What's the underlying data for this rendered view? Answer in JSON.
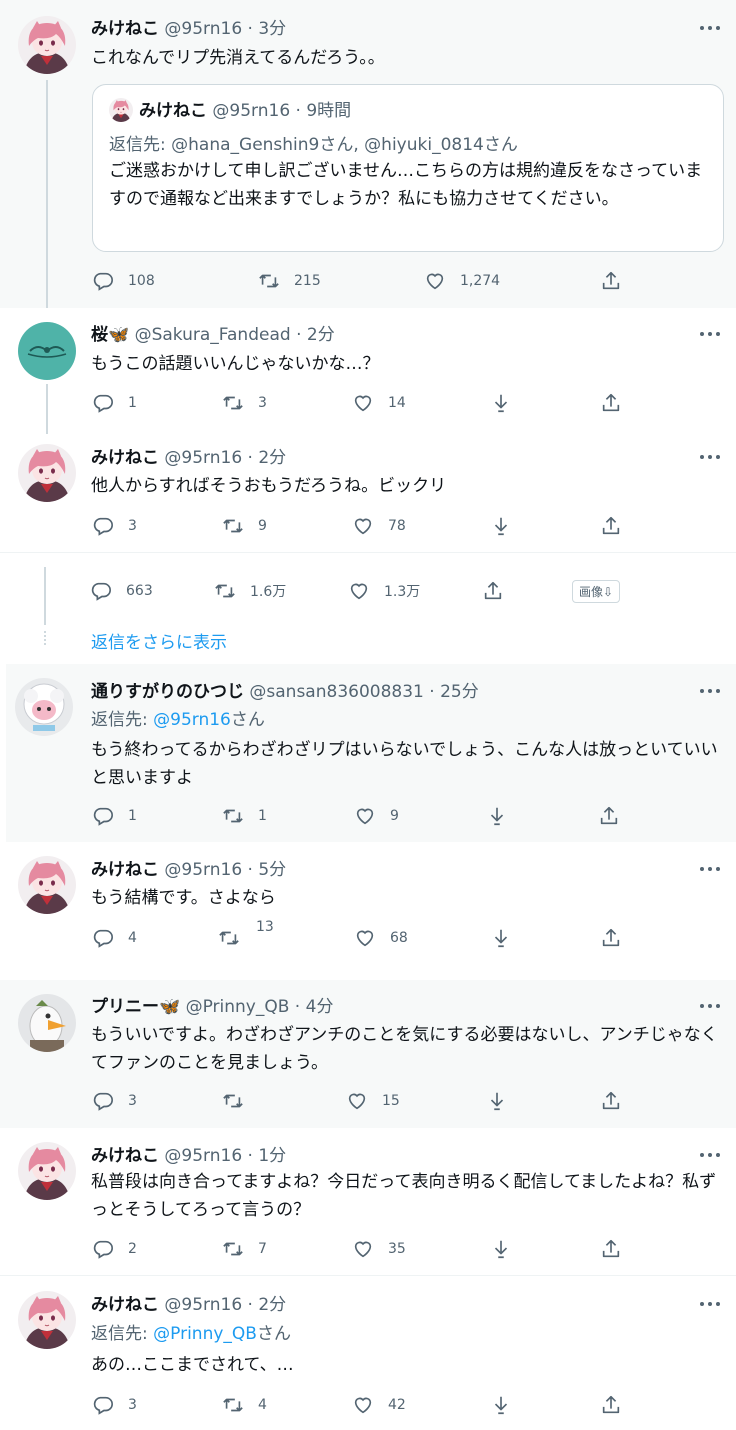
{
  "tweets": [
    {
      "name": "みけねこ",
      "handle": "@95rn16",
      "time": "3分",
      "text": "これなんでリプ先消えてるんだろう。。",
      "replies": "108",
      "retweets": "215",
      "likes": "1,274"
    },
    {
      "name": "桜🦋",
      "handle": "@Sakura_Fandead",
      "time": "2分",
      "text": "もうこの話題いいんじゃないかな…？",
      "replies": "1",
      "retweets": "3",
      "likes": "14"
    },
    {
      "name": "みけねこ",
      "handle": "@95rn16",
      "time": "2分",
      "text": "他人からすればそうおもうだろうね。ビックリ",
      "replies": "3",
      "retweets": "9",
      "likes": "78"
    },
    {
      "name": "通りすがりのひつじ",
      "handle": "@sansan836008831",
      "time": "25分",
      "reply_prefix": "返信先: ",
      "reply_to": "@95rn16",
      "reply_suffix": "さん",
      "text": "もう終わってるからわざわざリプはいらないでしょう、こんな人は放っといていいと思いますよ",
      "replies": "1",
      "retweets": "1",
      "likes": "9"
    },
    {
      "name": "みけねこ",
      "handle": "@95rn16",
      "time": "5分",
      "text": "もう結構です。さよなら",
      "replies": "4",
      "retweets": "13",
      "likes": "68"
    },
    {
      "name": "プリニー🦋",
      "handle": "@Prinny_QB",
      "time": "4分",
      "text": "もういいですよ。わざわざアンチのことを気にする必要はないし、アンチじゃなくてファンのことを見ましょう。",
      "replies": "3",
      "retweets": "",
      "likes": "15"
    },
    {
      "name": "みけねこ",
      "handle": "@95rn16",
      "time": "1分",
      "text": "私普段は向き合ってますよね？今日だって表向き明るく配信してましたよね？私ずっとそうしてろって言うの？",
      "replies": "2",
      "retweets": "7",
      "likes": "35"
    },
    {
      "name": "みけねこ",
      "handle": "@95rn16",
      "time": "2分",
      "reply_prefix": "返信先: ",
      "reply_to": "@Prinny_QB",
      "reply_suffix": "さん",
      "text": "あの…ここまでされて、…",
      "replies": "3",
      "retweets": "4",
      "likes": "42"
    }
  ],
  "quote": {
    "name": "みけねこ",
    "handle": "@95rn16",
    "time": "9時間",
    "reply_line": "返信先: @hana_Genshin9さん, @hiyuki_0814さん",
    "text": "ご迷惑おかけして申し訳ございません…こちらの方は規約違反をなさっていますので通報など出来ますでしょうか？私にも協力させてください。"
  },
  "main_stats": {
    "replies": "663",
    "retweets": "1.6万",
    "likes": "1.3万",
    "image_button": "画像⇩"
  },
  "show_more": "返信をさらに表示",
  "icons": [
    "reply-icon",
    "retweet-icon",
    "like-icon",
    "download-icon",
    "share-icon",
    "more-icon"
  ],
  "colors": {
    "link": "#1d9bf0",
    "muted": "#536471",
    "gray_bg": "#f7f9f9",
    "line": "#cfd9de"
  }
}
